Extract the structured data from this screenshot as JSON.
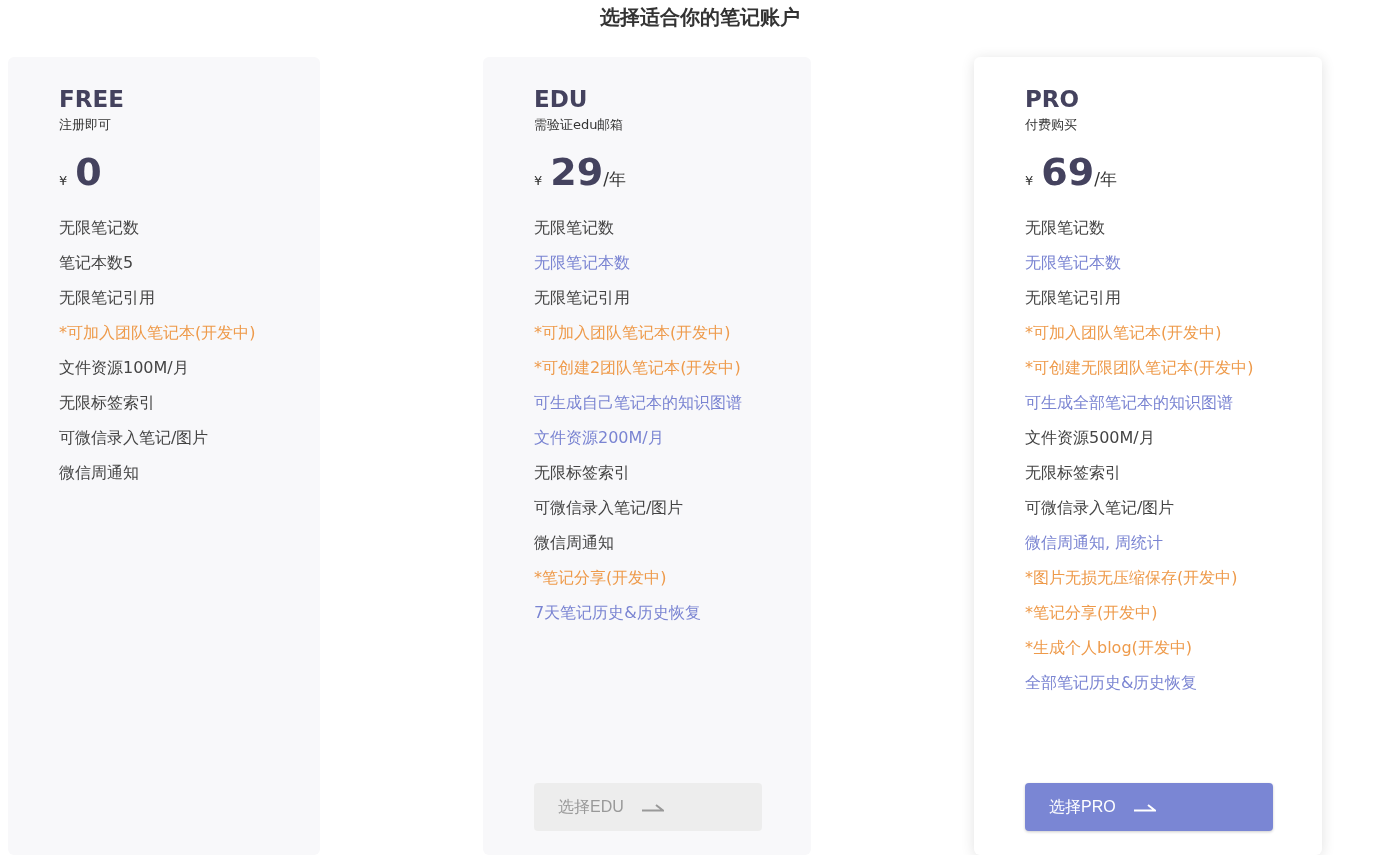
{
  "title": "选择适合你的笔记账户",
  "plans": [
    {
      "name": "FREE",
      "subtitle": "注册即可",
      "currency": "¥",
      "price": "0",
      "featured": false,
      "features": [
        {
          "text": "无限笔记数",
          "kind": "normal"
        },
        {
          "text": "笔记本数5",
          "kind": "normal"
        },
        {
          "text": "无限笔记引用",
          "kind": "normal"
        },
        {
          "text": "*可加入团队笔记本(开发中)",
          "kind": "dev"
        },
        {
          "text": "文件资源100M/月",
          "kind": "normal"
        },
        {
          "text": "无限标签索引",
          "kind": "normal"
        },
        {
          "text": "可微信录入笔记/图片",
          "kind": "normal"
        },
        {
          "text": "微信周通知",
          "kind": "normal"
        }
      ]
    },
    {
      "name": "EDU",
      "subtitle": "需验证edu邮箱",
      "currency": "¥",
      "price": "29",
      "period": "/年",
      "featured": false,
      "button": {
        "label": "选择EDU",
        "disabled": true
      },
      "features": [
        {
          "text": "无限笔记数",
          "kind": "normal"
        },
        {
          "text": "无限笔记本数",
          "kind": "plus"
        },
        {
          "text": "无限笔记引用",
          "kind": "normal"
        },
        {
          "text": "*可加入团队笔记本(开发中)",
          "kind": "dev"
        },
        {
          "text": "*可创建2团队笔记本(开发中)",
          "kind": "dev"
        },
        {
          "text": "可生成自己笔记本的知识图谱",
          "kind": "plus"
        },
        {
          "text": "文件资源200M/月",
          "kind": "plus"
        },
        {
          "text": "无限标签索引",
          "kind": "normal"
        },
        {
          "text": "可微信录入笔记/图片",
          "kind": "normal"
        },
        {
          "text": "微信周通知",
          "kind": "normal"
        },
        {
          "text": "*笔记分享(开发中)",
          "kind": "dev"
        },
        {
          "text": "7天笔记历史&历史恢复",
          "kind": "plus"
        }
      ]
    },
    {
      "name": "PRO",
      "subtitle": "付费购买",
      "currency": "¥",
      "price": "69",
      "period": "/年",
      "featured": true,
      "button": {
        "label": "选择PRO",
        "disabled": false
      },
      "features": [
        {
          "text": "无限笔记数",
          "kind": "normal"
        },
        {
          "text": "无限笔记本数",
          "kind": "plus"
        },
        {
          "text": "无限笔记引用",
          "kind": "normal"
        },
        {
          "text": "*可加入团队笔记本(开发中)",
          "kind": "dev"
        },
        {
          "text": "*可创建无限团队笔记本(开发中)",
          "kind": "dev"
        },
        {
          "text": "可生成全部笔记本的知识图谱",
          "kind": "plus"
        },
        {
          "text": "文件资源500M/月",
          "kind": "normal"
        },
        {
          "text": "无限标签索引",
          "kind": "normal"
        },
        {
          "text": "可微信录入笔记/图片",
          "kind": "normal"
        },
        {
          "text": "微信周通知, 周统计",
          "kind": "plus"
        },
        {
          "text": "*图片无损无压缩保存(开发中)",
          "kind": "dev"
        },
        {
          "text": "*笔记分享(开发中)",
          "kind": "dev"
        },
        {
          "text": "*生成个人blog(开发中)",
          "kind": "dev"
        },
        {
          "text": "全部笔记历史&历史恢复",
          "kind": "plus"
        }
      ]
    }
  ]
}
